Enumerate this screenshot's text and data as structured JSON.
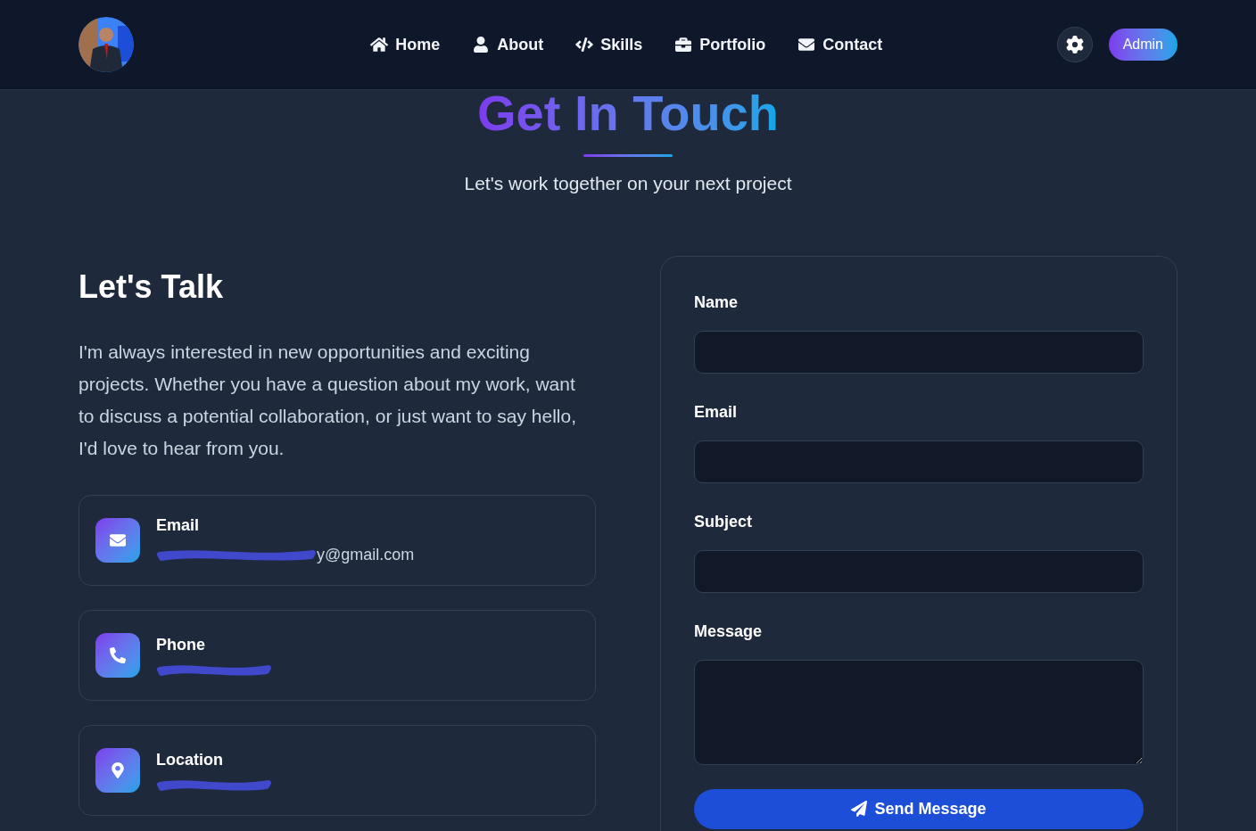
{
  "nav": {
    "items": [
      {
        "label": "Home",
        "kind": "home"
      },
      {
        "label": "About",
        "kind": "user"
      },
      {
        "label": "Skills",
        "kind": "code"
      },
      {
        "label": "Portfolio",
        "kind": "briefcase"
      },
      {
        "label": "Contact",
        "kind": "mail"
      }
    ],
    "admin_button": "Admin"
  },
  "hero": {
    "title": "Get In Touch",
    "subtitle": "Let's work together on your next project"
  },
  "intro": {
    "heading": "Let's Talk",
    "paragraph": "I'm always interested in new opportunities and exciting projects. Whether you have a question about my work, want to discuss a potential collaboration, or just want to say hello, I'd love to hear from you."
  },
  "contacts": [
    {
      "label": "Email",
      "kind": "mail",
      "value": "y@gmail.com"
    },
    {
      "label": "Phone",
      "kind": "phone"
    },
    {
      "label": "Location",
      "kind": "pin"
    }
  ],
  "form": {
    "fields": [
      {
        "label": "Name",
        "kind": "input"
      },
      {
        "label": "Email",
        "kind": "input"
      },
      {
        "label": "Subject",
        "kind": "input"
      },
      {
        "label": "Message",
        "kind": "textarea"
      }
    ],
    "submit": "Send Message"
  }
}
